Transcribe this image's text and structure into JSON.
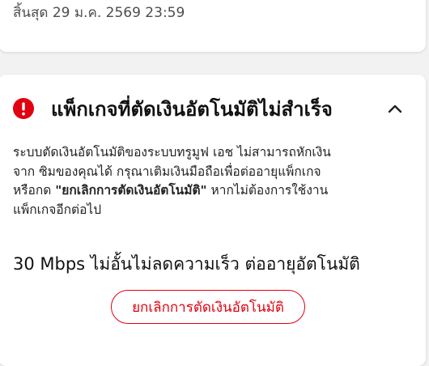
{
  "expiry": {
    "text": "สิ้นสุด 29 ม.ค. 2569 23:59"
  },
  "alert": {
    "icon": "exclamation-circle-icon",
    "icon_color": "#e1000f",
    "title": "แพ็กเกจที่ตัดเงินอัตโนมัติไม่สำเร็จ",
    "toggle_icon": "chevron-up-icon",
    "description_line1": "ระบบตัดเงินอัตโนมัติของระบบทรูมูฟ เอช ไม่สามารถหักเงิน",
    "description_line2": "จาก ซิมของคุณได้ กรุณาเติมเงินมือถือเพื่อต่ออายุแพ็กเกจ",
    "description_line3_prefix": "หรือกด ",
    "description_line3_bold": "\"ยกเลิกการตัดเงินอัตโนมัติ\"",
    "description_line3_suffix": " หากไม่ต้องการใช้งาน",
    "description_line4": "แพ็กเกจอีกต่อไป"
  },
  "package": {
    "name": "30 Mbps ไม่อั้นไม่ลดความเร็ว ต่ออายุอัตโนมัติ"
  },
  "actions": {
    "cancel_auto_renew_label": "ยกเลิกการตัดเงินอัตโนมัติ",
    "accent_color": "#e1000f"
  }
}
